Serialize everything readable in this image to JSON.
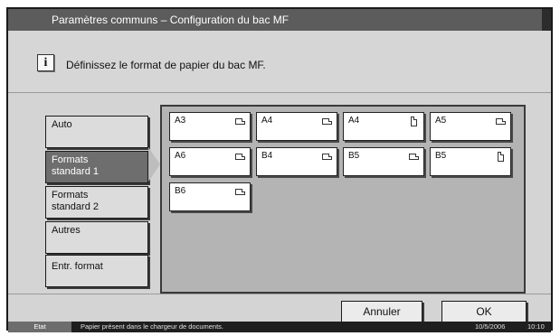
{
  "title": "Paramètres communs – Configuration du bac MF",
  "message": "Définissez le format de papier du bac MF.",
  "info_icon": {
    "icon": "info-icon",
    "glyph": "i"
  },
  "categories": [
    {
      "label_line1": "Auto",
      "label_line2": "",
      "selected": false
    },
    {
      "label_line1": "Formats",
      "label_line2": "standard 1",
      "selected": true
    },
    {
      "label_line1": "Formats",
      "label_line2": "standard 2",
      "selected": false
    },
    {
      "label_line1": "Autres",
      "label_line2": "",
      "selected": false
    },
    {
      "label_line1": "Entr. format",
      "label_line2": "",
      "selected": false
    }
  ],
  "sizes": [
    {
      "label": "A3",
      "orientation": "landscape"
    },
    {
      "label": "A4",
      "orientation": "landscape"
    },
    {
      "label": "A4",
      "orientation": "portrait"
    },
    {
      "label": "A5",
      "orientation": "landscape"
    },
    {
      "label": "A6",
      "orientation": "landscape"
    },
    {
      "label": "B4",
      "orientation": "landscape"
    },
    {
      "label": "B5",
      "orientation": "landscape"
    },
    {
      "label": "B5",
      "orientation": "portrait"
    },
    {
      "label": "B6",
      "orientation": "landscape"
    }
  ],
  "actions": {
    "cancel": "Annuler",
    "ok": "OK"
  },
  "status": {
    "state": "Etat",
    "message": "Papier présent dans le chargeur de documents.",
    "date": "10/5/2006",
    "time": "10:10"
  },
  "colors": {
    "title_bar": "#5c5c5c",
    "selected_category": "#6e6e6e",
    "panel": "#b4b4b4",
    "status_bar": "#1f1f1f"
  }
}
